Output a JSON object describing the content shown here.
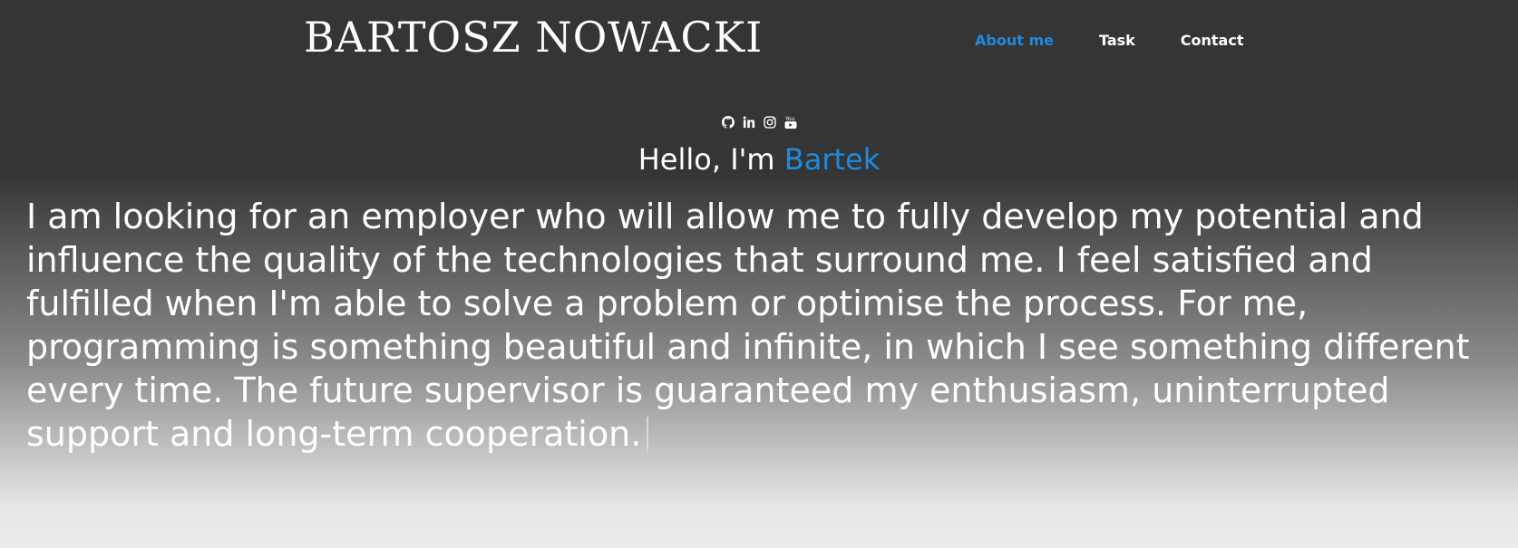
{
  "header": {
    "logo": "BARTOSZ NOWACKI",
    "nav": [
      {
        "label": "About me",
        "active": true
      },
      {
        "label": "Task",
        "active": false
      },
      {
        "label": "Contact",
        "active": false
      }
    ]
  },
  "social": {
    "icons": [
      "github-icon",
      "linkedin-icon",
      "instagram-icon",
      "youtube-icon"
    ]
  },
  "hero": {
    "greeting": "Hello, I'm",
    "name": "Bartek",
    "about": "I am looking for an employer who will allow me to fully develop my potential and influence the quality of the technologies that surround me. I feel satisfied and fulfilled when I'm able to solve a problem or optimise the process. For me, programming is something beautiful and infinite, in which I see something different every time. The future supervisor is guaranteed my enthusiasm, uninterrupted support and long-term cooperation."
  },
  "colors": {
    "background_top": "#353535",
    "background_bottom": "#ececec",
    "accent": "#1e8be0",
    "text": "#ffffff"
  }
}
